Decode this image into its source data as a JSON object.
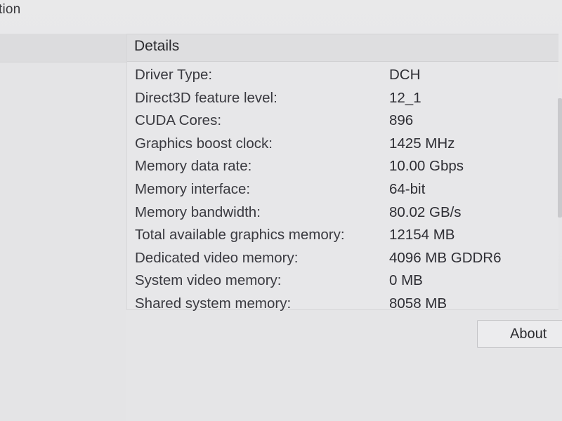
{
  "window": {
    "title": "tion"
  },
  "details": {
    "header": "Details",
    "rows": [
      {
        "label": "Driver Type:",
        "value": "DCH"
      },
      {
        "label": "Direct3D feature level:",
        "value": "12_1"
      },
      {
        "label": "CUDA Cores:",
        "value": "896"
      },
      {
        "label": "Graphics boost clock:",
        "value": "1425 MHz"
      },
      {
        "label": "Memory data rate:",
        "value": "10.00 Gbps"
      },
      {
        "label": "Memory interface:",
        "value": "64-bit"
      },
      {
        "label": "Memory bandwidth:",
        "value": "80.02 GB/s"
      },
      {
        "label": "Total available graphics memory:",
        "value": "12154 MB"
      },
      {
        "label": "Dedicated video memory:",
        "value": "4096 MB GDDR6"
      },
      {
        "label": "System video memory:",
        "value": "0 MB"
      },
      {
        "label": "Shared system memory:",
        "value": "8058 MB"
      }
    ]
  },
  "buttons": {
    "about": "About"
  }
}
